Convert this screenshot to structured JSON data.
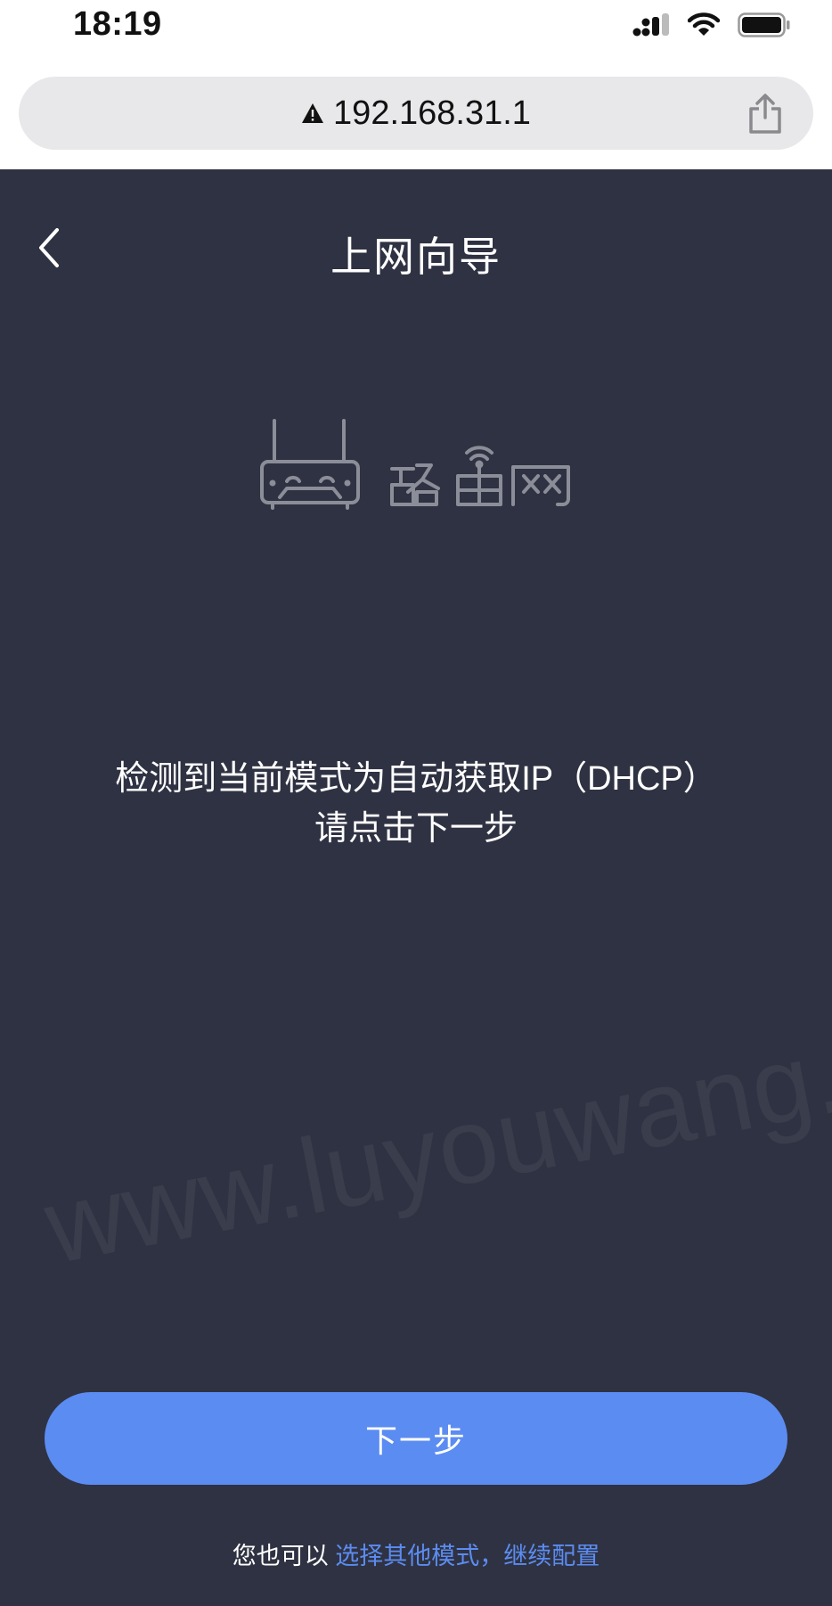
{
  "status_bar": {
    "time": "18:19"
  },
  "browser": {
    "address": "192.168.31.1",
    "security_icon": "warning-triangle-icon",
    "share_icon": "share-icon"
  },
  "app": {
    "title": "上网向导",
    "back_icon": "chevron-left-icon",
    "logo_text": "路由网",
    "message_line1": "检测到当前模式为自动获取IP（DHCP）",
    "message_line2": "请点击下一步",
    "watermark": "www.luyouwang.net",
    "next_button_label": "下一步",
    "footer_prefix": "您也可以 ",
    "footer_link": "选择其他模式，继续配置"
  },
  "colors": {
    "background": "#2f3242",
    "accent": "#5b8cf1",
    "text": "#ffffff"
  }
}
